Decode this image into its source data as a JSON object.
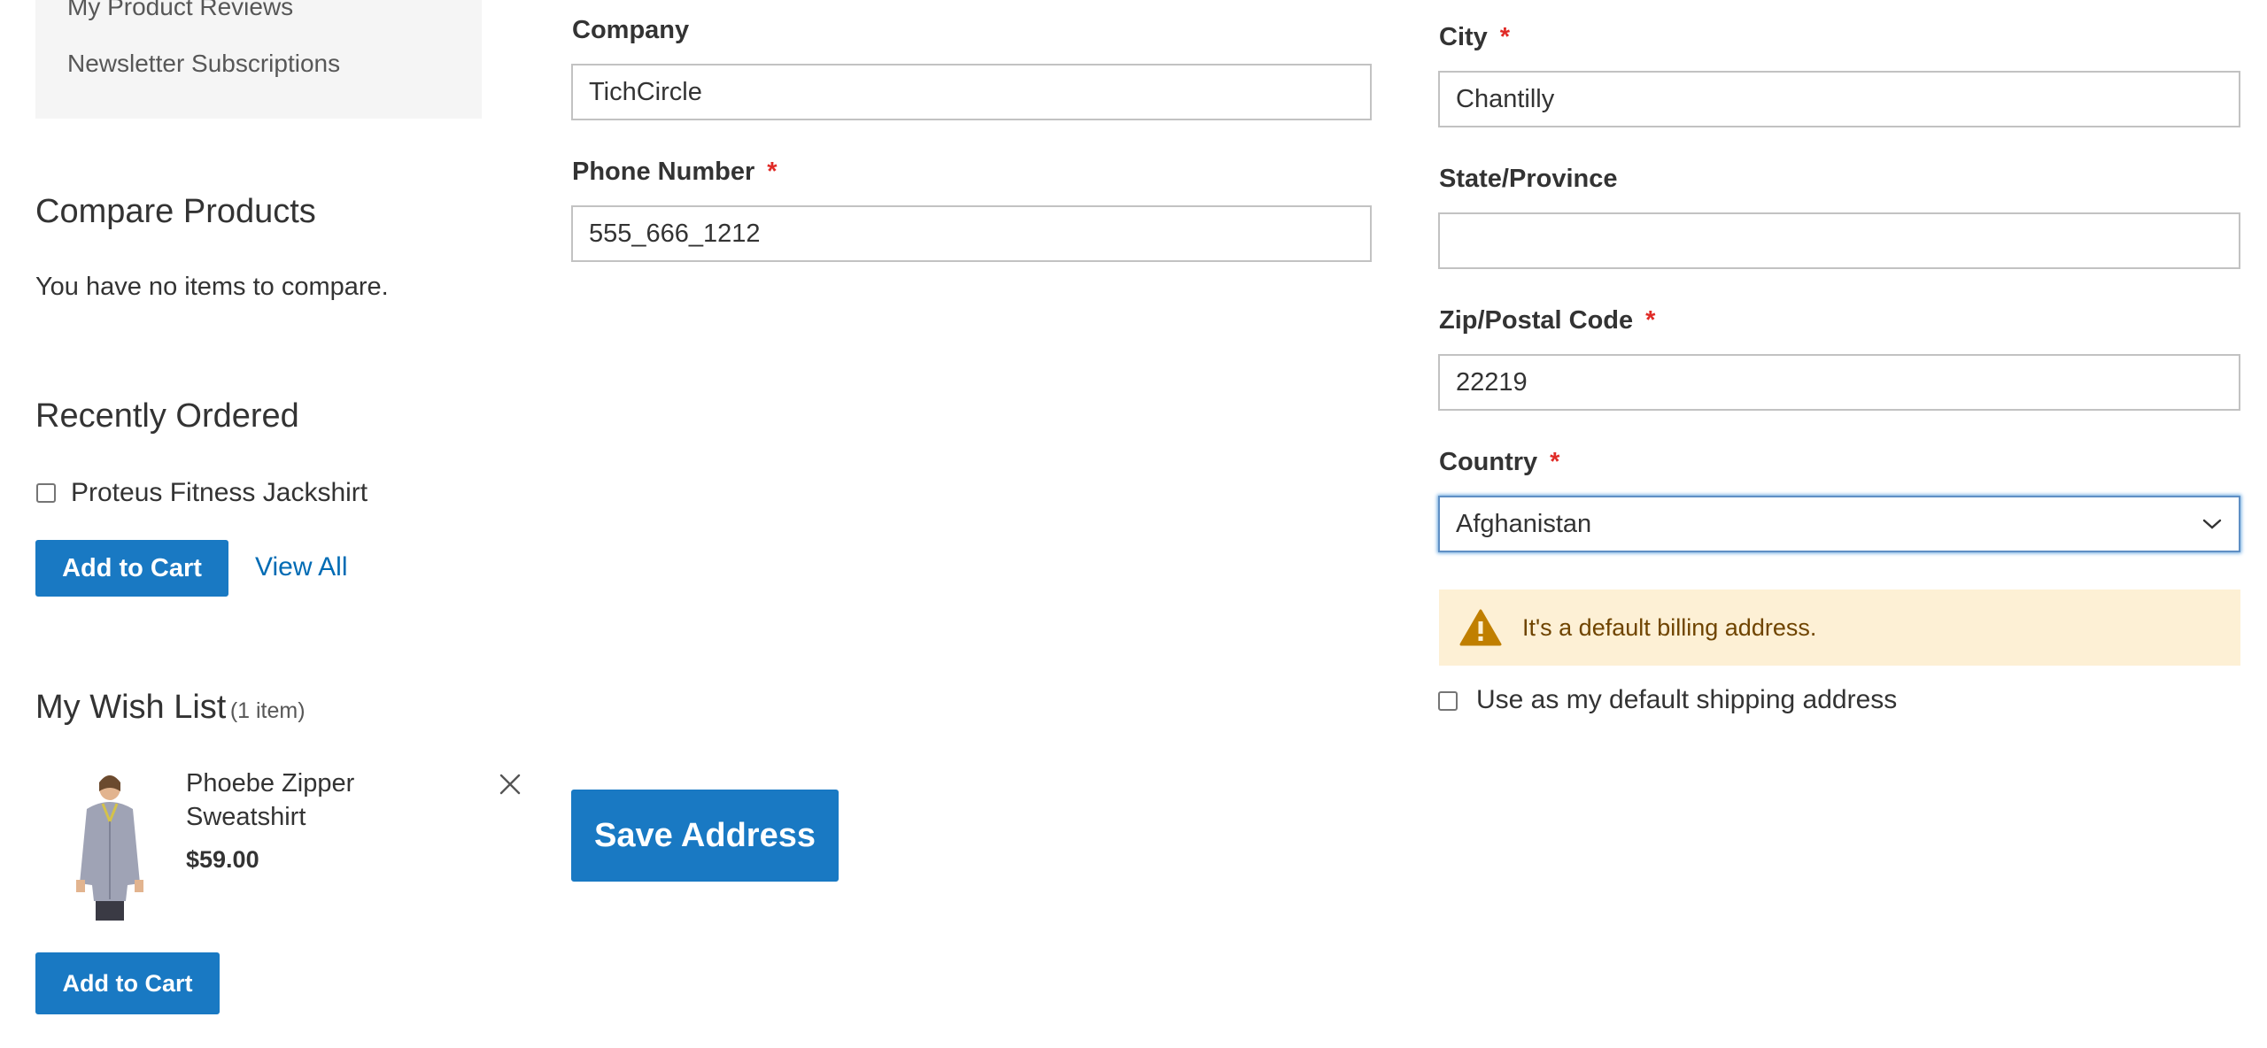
{
  "sidebar": {
    "nav_items": [
      "My Product Reviews",
      "Newsletter Subscriptions"
    ],
    "compare": {
      "title": "Compare Products",
      "empty_text": "You have no items to compare."
    },
    "recently_ordered": {
      "title": "Recently Ordered",
      "item_name": "Proteus Fitness Jackshirt",
      "add_to_cart_label": "Add to Cart",
      "view_all_label": "View All"
    },
    "wishlist": {
      "title": "My Wish List",
      "count_label": "(1 item)",
      "item_name": "Phoebe Zipper Sweatshirt",
      "item_price": "$59.00",
      "add_to_cart_label": "Add to Cart",
      "remove_icon": "close-icon"
    }
  },
  "form": {
    "company": {
      "label": "Company",
      "value": "TichCircle",
      "required": false
    },
    "phone": {
      "label": "Phone Number",
      "value": "555_666_1212",
      "required": true
    },
    "city": {
      "label": "City",
      "value": "Chantilly",
      "required": true
    },
    "state": {
      "label": "State/Province",
      "value": "",
      "required": false
    },
    "zip": {
      "label": "Zip/Postal Code",
      "value": "22219",
      "required": true
    },
    "country": {
      "label": "Country",
      "value": "Afghanistan",
      "required": true
    },
    "required_marker": "*",
    "notice_text": "It's a default billing address.",
    "shipping_checkbox_label": "Use as my default shipping address",
    "save_label": "Save Address"
  },
  "colors": {
    "primary": "#1979c3",
    "link": "#006bb4",
    "required": "#e02b27",
    "notice_bg": "#fdf0d5",
    "notice_icon": "#c07f00"
  }
}
